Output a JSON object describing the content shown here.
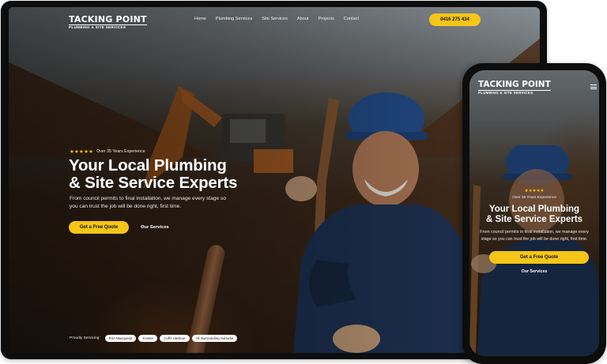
{
  "brand": {
    "name_line1": "TACKING POINT",
    "name_line2": "PLUMBING & SITE SERVICES"
  },
  "nav": {
    "items": [
      "Home",
      "Plumbing Services",
      "Site Services",
      "About",
      "Projects",
      "Contact"
    ],
    "phone": "0416 275 434"
  },
  "hero": {
    "stars": "★★★★★",
    "experience": "Over 35 Years Experience",
    "headline_line1": "Your Local Plumbing",
    "headline_line2": "& Site Service Experts",
    "subtext": "From council permits to final installation, we manage every stage so you can trust the job will be done right, first time.",
    "cta_primary": "Get a Free Quote",
    "cta_secondary": "Our Services"
  },
  "service_areas": {
    "label": "Proudly Servicing:",
    "areas": [
      "Port Macquarie",
      "Forster",
      "Coffs Harbour",
      "All Surrounding Suburbs"
    ]
  },
  "colors": {
    "accent": "#f5c518",
    "frame": "#0d0d0d",
    "text_light": "#ffffff"
  },
  "icons": {
    "menu": "hamburger-icon",
    "rating": "star-icon"
  }
}
